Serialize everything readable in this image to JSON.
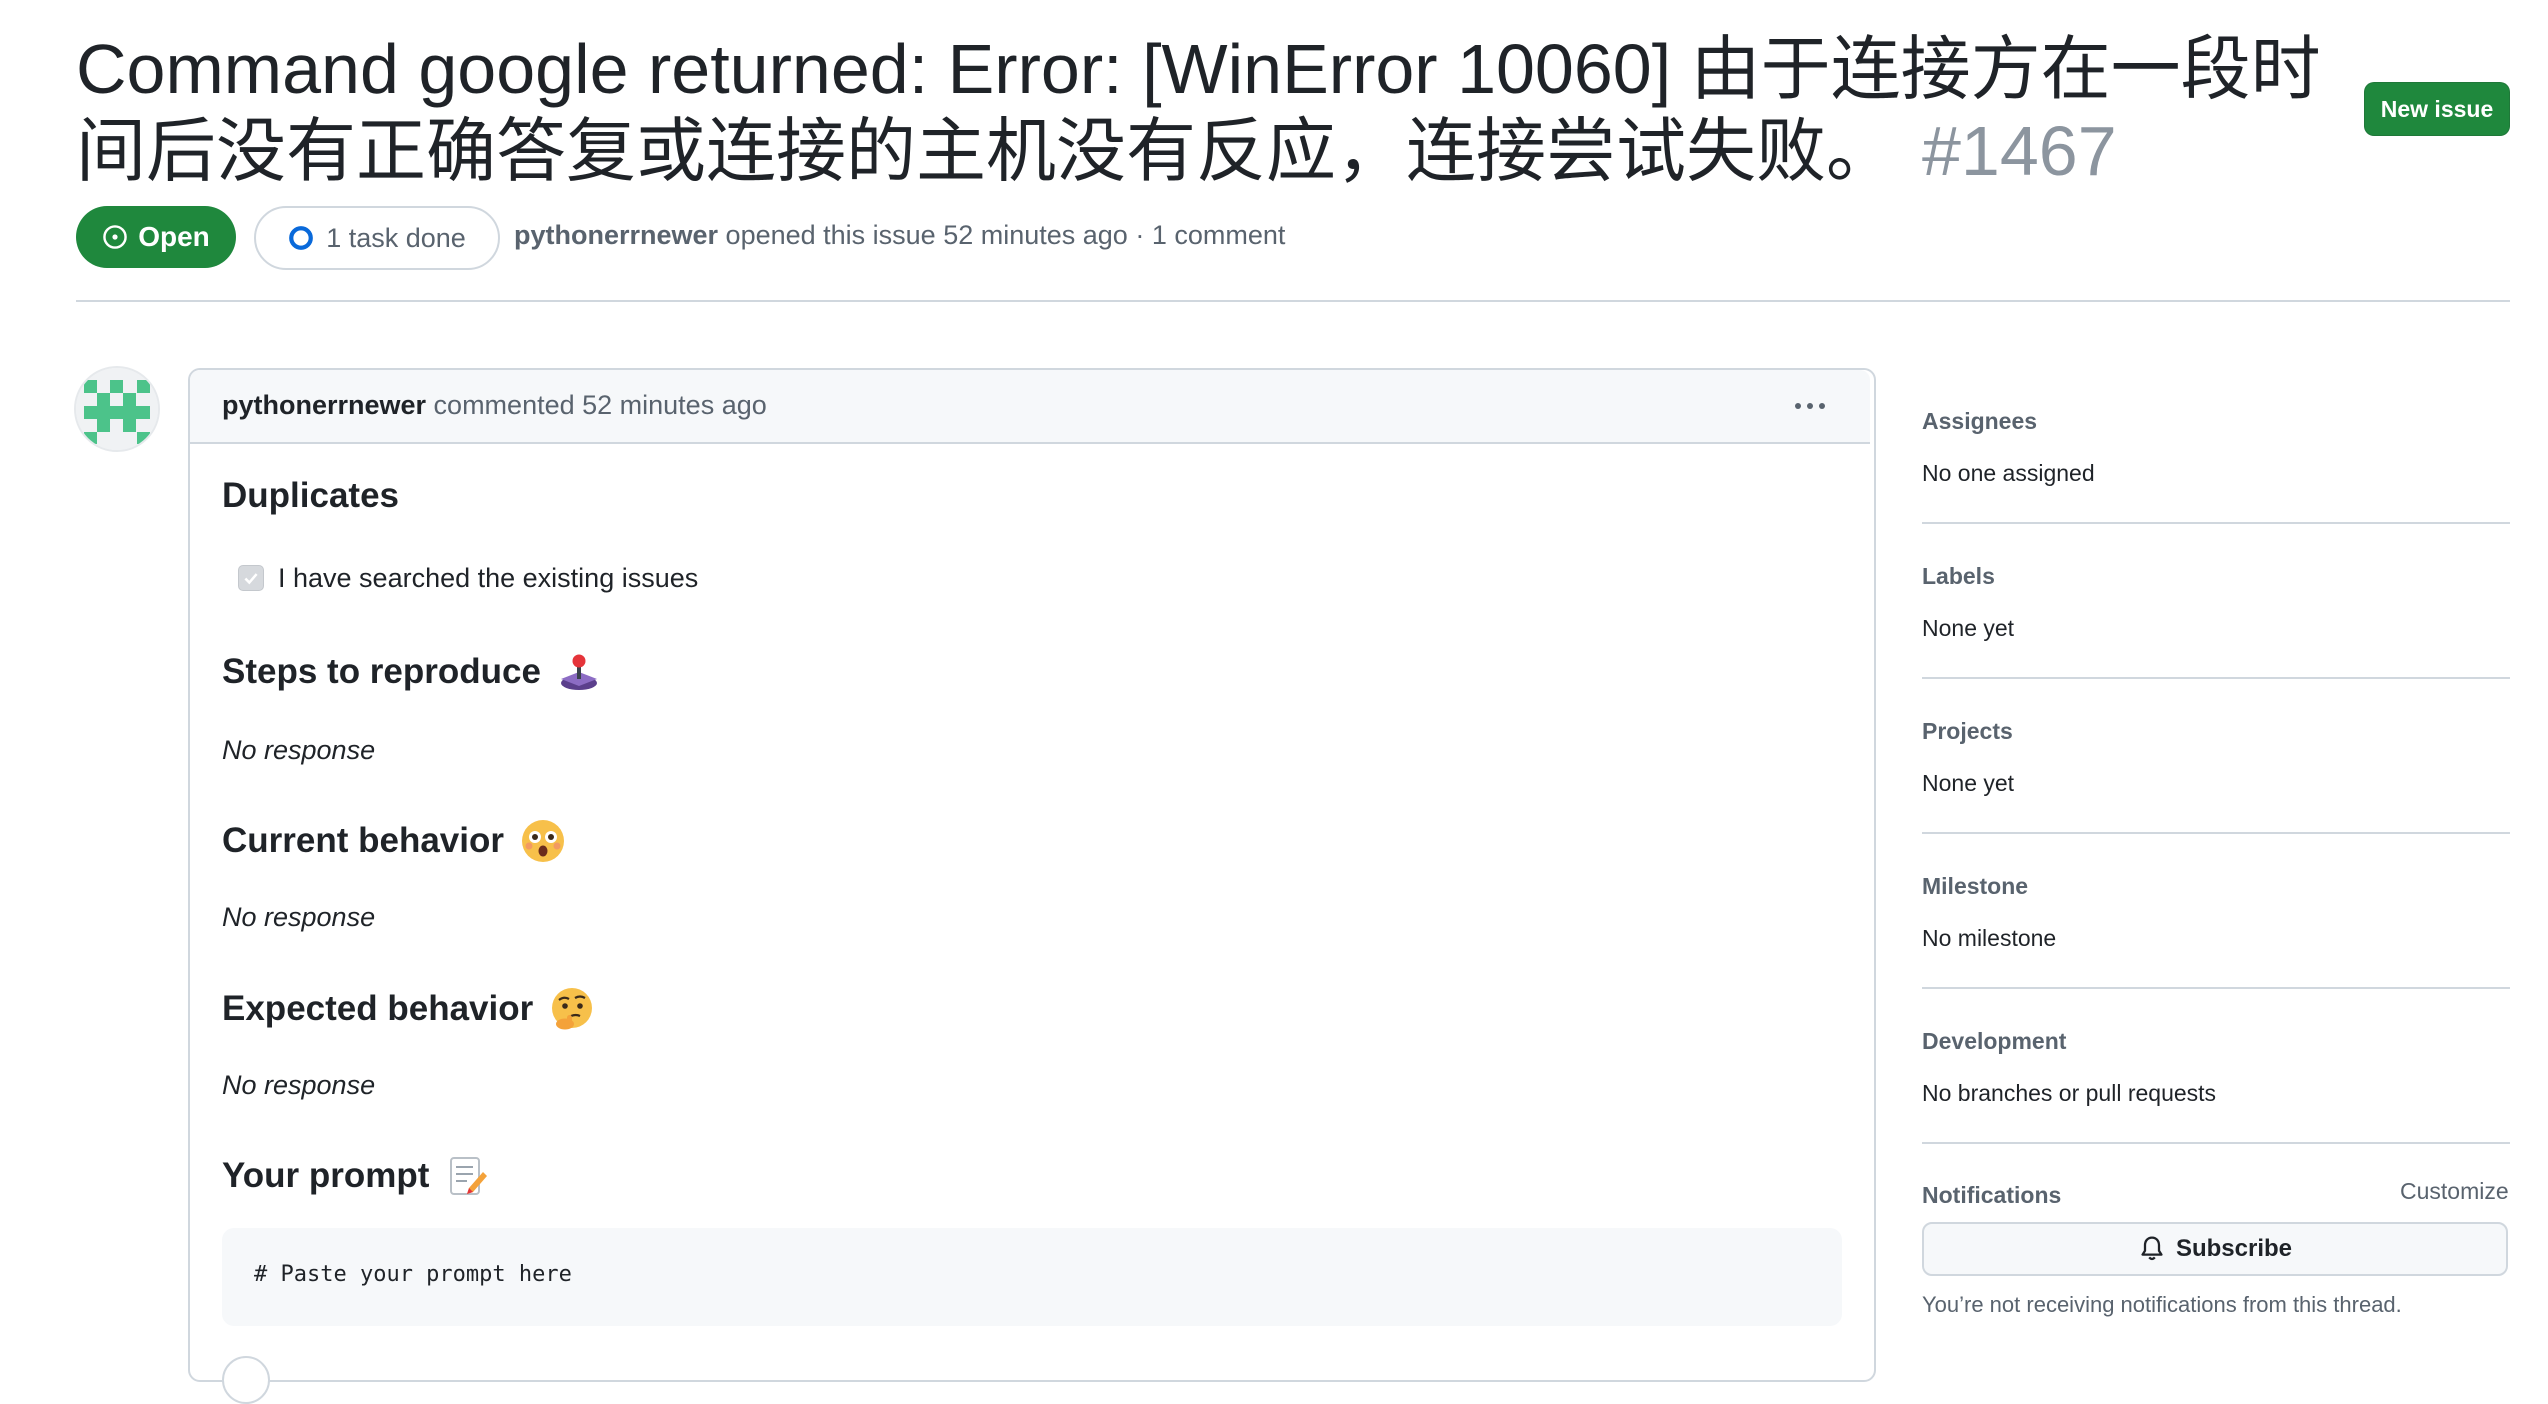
{
  "issue": {
    "title": "Command google returned: Error: [WinError 10060] 由于连接方在一段时间后没有正确答复或连接的主机没有反应，连接尝试失败。",
    "number": "#1467",
    "state_label": "Open",
    "tasks_label": "1 task done",
    "author": "pythonerrnewer",
    "opened_text": " opened this issue 52 minutes ago · 1 comment",
    "new_issue_label": "New issue",
    "colors": {
      "open_green": "#1f883d",
      "muted": "#59636e",
      "border": "#d0d7de"
    }
  },
  "comment": {
    "author": "pythonerrnewer",
    "action_text": " commented 52 minutes ago",
    "more_icon": "kebab-horizontal-icon",
    "sections": {
      "duplicates": {
        "heading": "Duplicates",
        "checkbox_label": "I have searched the existing issues",
        "checked": true
      },
      "steps": {
        "heading": "Steps to reproduce",
        "emoji": "🕹️",
        "icon": "joystick-icon",
        "body": "No response"
      },
      "current": {
        "heading": "Current behavior",
        "emoji": "😯",
        "icon": "hushed-face-icon",
        "body": "No response"
      },
      "expected": {
        "heading": "Expected behavior",
        "emoji": "🤔",
        "icon": "thinking-face-icon",
        "body": "No response"
      },
      "prompt": {
        "heading": "Your prompt",
        "emoji": "📝",
        "icon": "memo-icon",
        "code": "# Paste your prompt here"
      }
    }
  },
  "sidebar": {
    "assignees": {
      "heading": "Assignees",
      "value": "No one assigned"
    },
    "labels": {
      "heading": "Labels",
      "value": "None yet"
    },
    "projects": {
      "heading": "Projects",
      "value": "None yet"
    },
    "milestone": {
      "heading": "Milestone",
      "value": "No milestone"
    },
    "development": {
      "heading": "Development",
      "value": "No branches or pull requests"
    },
    "notifications": {
      "heading": "Notifications",
      "customize_label": "Customize",
      "subscribe_label": "Subscribe",
      "note": "You’re not receiving notifications from this thread."
    }
  }
}
